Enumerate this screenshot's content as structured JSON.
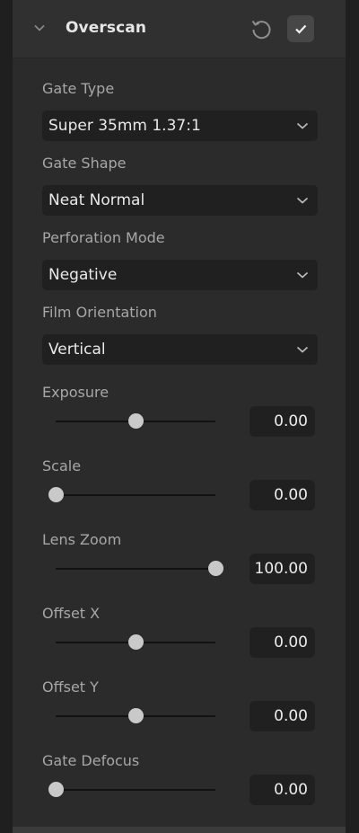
{
  "header": {
    "title": "Overscan"
  },
  "icons": {
    "collapse": "chevron-down-icon",
    "reset": "reset-icon",
    "confirm": "check-icon"
  },
  "fields": {
    "gate_type": {
      "label": "Gate Type",
      "value": "Super 35mm 1.37:1"
    },
    "gate_shape": {
      "label": "Gate Shape",
      "value": "Neat Normal"
    },
    "perforation_mode": {
      "label": "Perforation Mode",
      "value": "Negative"
    },
    "film_orientation": {
      "label": "Film Orientation",
      "value": "Vertical"
    }
  },
  "sliders": {
    "exposure": {
      "label": "Exposure",
      "value": "0.00",
      "fraction": 0.5
    },
    "scale": {
      "label": "Scale",
      "value": "0.00",
      "fraction": 0.0
    },
    "lens_zoom": {
      "label": "Lens Zoom",
      "value": "100.00",
      "fraction": 1.0
    },
    "offset_x": {
      "label": "Offset X",
      "value": "0.00",
      "fraction": 0.5
    },
    "offset_y": {
      "label": "Offset Y",
      "value": "0.00",
      "fraction": 0.5
    },
    "gate_defocus": {
      "label": "Gate Defocus",
      "value": "0.00",
      "fraction": 0.0
    }
  },
  "colors": {
    "panel_bg": "#2b2b2b",
    "field_bg": "#202020",
    "label_text": "#a7a7a7",
    "value_text": "#e9e9e9",
    "knob": "#c9c9c9"
  }
}
